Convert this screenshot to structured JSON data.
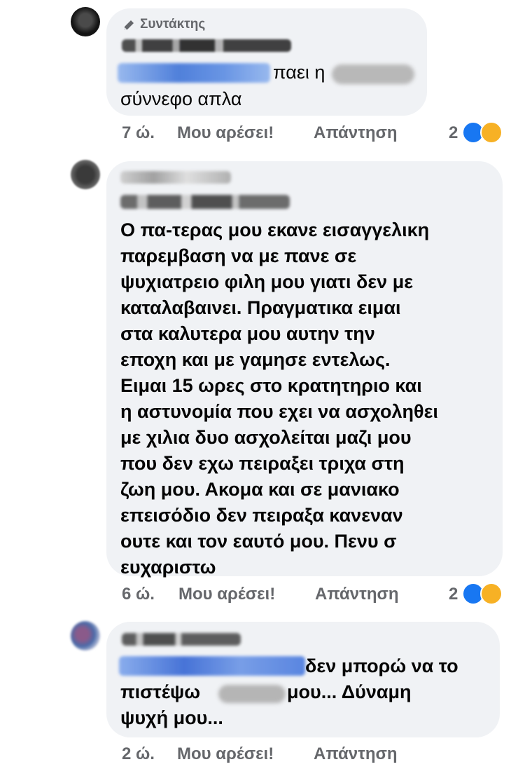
{
  "comments": [
    {
      "badge": "Συντάκτης",
      "lines": [
        "παει η",
        "σύννεφο απλα"
      ],
      "time": "7 ώ.",
      "like_label": "Μου αρέσει!",
      "reply_label": "Απάντηση",
      "reaction_count": "2"
    },
    {
      "lines": [
        "Ο πα-τερας μου εκανε εισαγγελικη",
        "παρεμβαση να με πανε σε",
        "ψυχιατρειο φιλη μου γιατι δεν με",
        "καταλαβαινει. Πραγματικα ειμαι",
        "στα καλυτερα μου αυτην την",
        "εποχη και με γαμησε εντελως.",
        "Ειμαι 15 ωρες στο κρατητηριο και",
        "η αστυνομία που εχει να ασχοληθει",
        "με χιλια δυο ασχολείται μαζι μου",
        "που δεν εχω πειραξει τριχα στη",
        "ζωη μου. Ακομα και σε μανιακο",
        "επεισόδιο δεν πειραξα κανεναν",
        "ουτε και τον εαυτό μου. Πενυ σ",
        "ευχαριστω"
      ],
      "time": "6 ώ.",
      "like_label": "Μου αρέσει!",
      "reply_label": "Απάντηση",
      "reaction_count": "2"
    },
    {
      "lines": [
        "δεν μπορώ να το",
        "πιστέψω",
        "μου... Δύναμη",
        "ψυχή μου..."
      ],
      "time": "2 ώ.",
      "like_label": "Μου αρέσει!",
      "reply_label": "Απάντηση"
    }
  ],
  "colors": {
    "bubble": "#f0f2f5",
    "meta": "#65676b",
    "like": "#1877f2",
    "sad": "#f7b125",
    "tag": "#1b74e4"
  },
  "icons": [
    "pencil-icon",
    "like-reaction-icon",
    "sad-reaction-icon"
  ]
}
